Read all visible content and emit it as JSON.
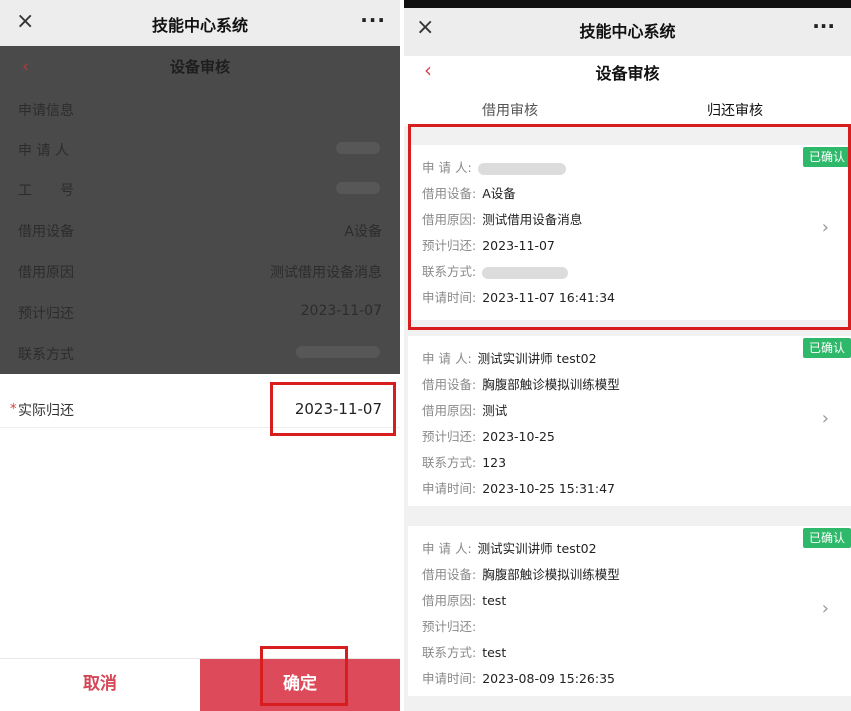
{
  "left": {
    "app_title": "技能中心系统",
    "close_icon": "×",
    "more_icon": "···",
    "page_title": "设备审核",
    "back_icon": "‹",
    "section_header": "申请信息",
    "applicant_label": "申 请 人",
    "job_no_label": "工　　号",
    "device_label": "借用设备",
    "device_value": "A设备",
    "reason_label": "借用原因",
    "reason_value": "测试借用设备消息",
    "expected_return_label": "预计归还",
    "expected_return_value": "2023-11-07",
    "contact_label": "联系方式",
    "required_mark": "*",
    "actual_return_label": "实际归还",
    "actual_return_value": "2023-11-07",
    "cancel_label": "取消",
    "confirm_label": "确定"
  },
  "right": {
    "app_title": "技能中心系统",
    "close_icon": "×",
    "more_icon": "···",
    "page_title": "设备审核",
    "back_icon": "‹",
    "tabs": [
      "借用审核",
      "归还审核"
    ],
    "active_tab": "归还审核",
    "field_labels": {
      "applicant": "申 请 人:",
      "device": "借用设备:",
      "reason": "借用原因:",
      "expected_return": "预计归还:",
      "contact": "联系方式:",
      "apply_time": "申请时间:"
    },
    "cards": [
      {
        "status": "已确认",
        "applicant": "",
        "device": "A设备",
        "reason": "测试借用设备消息",
        "expected_return": "2023-11-07",
        "contact": "",
        "apply_time": "2023-11-07 16:41:34"
      },
      {
        "status": "已确认",
        "applicant": "测试实训讲师 test02",
        "device": "胸腹部触诊模拟训练模型",
        "reason": "测试",
        "expected_return": "2023-10-25",
        "contact": "123",
        "apply_time": "2023-10-25 15:31:47"
      },
      {
        "status": "已确认",
        "applicant": "测试实训讲师 test02",
        "device": "胸腹部触诊模拟训练模型",
        "reason": "test",
        "expected_return": "",
        "contact": "test",
        "apply_time": "2023-08-09 15:26:35"
      }
    ],
    "chevron_icon": "›"
  },
  "colors": {
    "accent": "#dd4b5a",
    "badge": "#2eb86a",
    "highlight": "#d71d1d",
    "overlay": "#4a4a4a"
  }
}
